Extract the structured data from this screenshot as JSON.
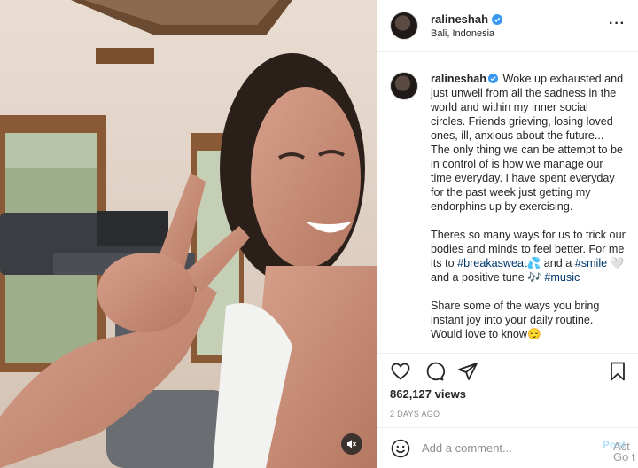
{
  "post": {
    "username": "ralineshah",
    "location": "Bali, Indonesia",
    "more_icon": "more-icon",
    "caption_paragraphs": [
      "Woke up exhausted and just unwell from all the sadness in the world and within my inner social circles. Friends grieving, losing loved ones, ill, anxious about the future... The only thing we can be attempt to be in control of is how we manage our time everyday. I have spent everyday for the past week just getting my endorphins up by exercising."
    ],
    "para2_a": "Theres so many ways for us to trick our bodies and minds to feel better. For me its to ",
    "para2_tag1": "#breakasweat",
    "para2_b": "💦 and a ",
    "para2_tag2": "#smile",
    "para2_c": " 🤍 and a positive tune 🎶 ",
    "para2_tag3": "#music",
    "para3": "Share some of the ways you bring instant joy into your daily routine. Would love to know😌",
    "views": "862,127 views",
    "time": "2 DAYS AGO",
    "comment_placeholder": "Add a comment...",
    "post_label": "Post",
    "watermark": "Act Go t"
  },
  "colors": {
    "verified": "#3897f0",
    "link": "#00376b",
    "post": "#b2dffc"
  }
}
